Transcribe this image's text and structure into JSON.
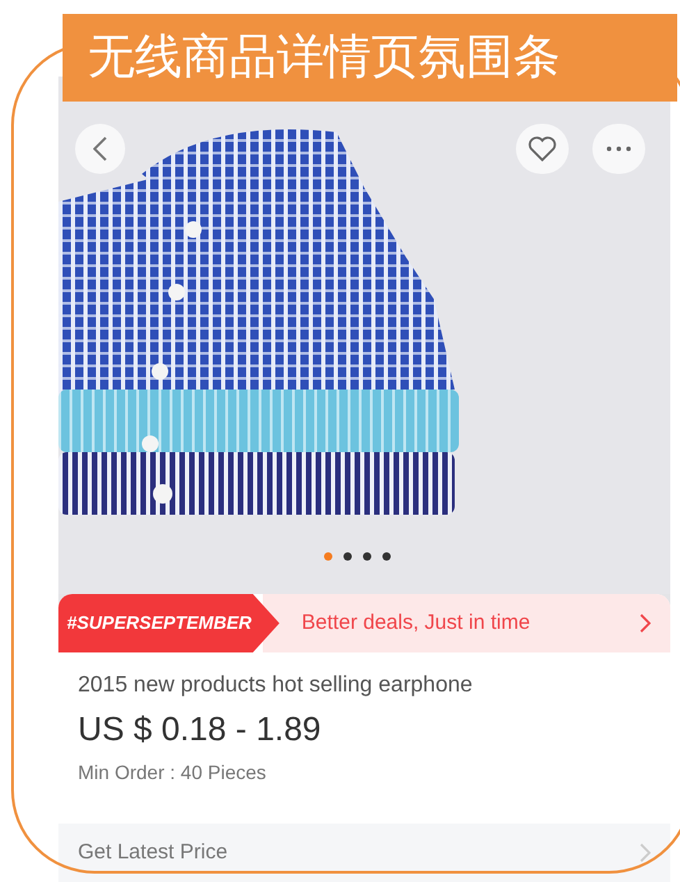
{
  "banner": {
    "title": "无线商品详情页氛围条"
  },
  "gallery": {
    "dots": [
      {
        "selected": true
      },
      {
        "selected": false
      },
      {
        "selected": false
      },
      {
        "selected": false
      }
    ]
  },
  "promo": {
    "tag": "#SUPERSEPTEMBER",
    "text": "Better deals, Just in time"
  },
  "product": {
    "title": "2015 new products hot selling earphone",
    "price": "US $ 0.18 - 1.89",
    "min_order": "Min Order : 40 Pieces"
  },
  "price_row": {
    "label": "Get Latest Price"
  }
}
